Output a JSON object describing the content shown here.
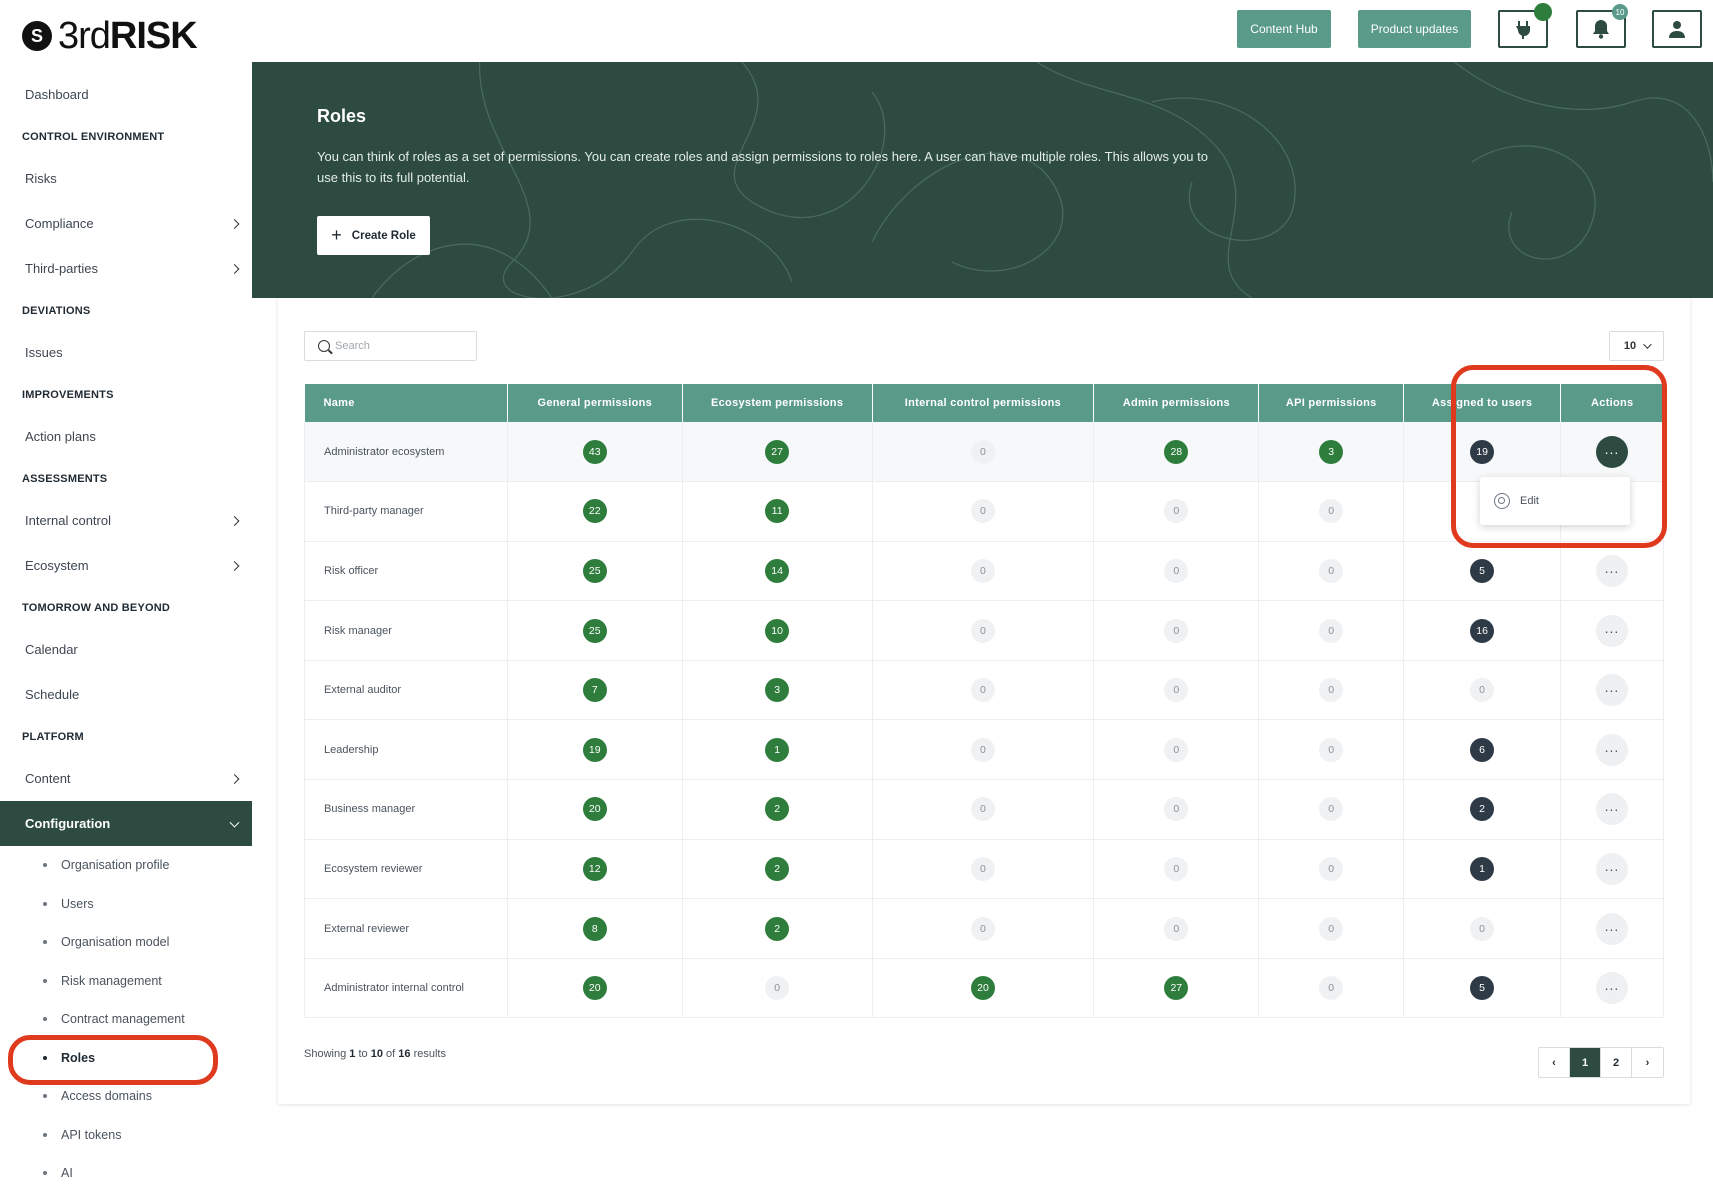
{
  "logo": {
    "mark": "S",
    "text_thin": "3rd",
    "text_bold": "RISK"
  },
  "topbar": {
    "content_hub": "Content Hub",
    "product_updates": "Product updates",
    "notification_count": "10"
  },
  "sidebar": {
    "dashboard": "Dashboard",
    "sec_control": "CONTROL ENVIRONMENT",
    "risks": "Risks",
    "compliance": "Compliance",
    "third_parties": "Third-parties",
    "sec_deviations": "DEVIATIONS",
    "issues": "Issues",
    "sec_improvements": "IMPROVEMENTS",
    "action_plans": "Action plans",
    "sec_assessments": "ASSESSMENTS",
    "internal_control": "Internal control",
    "ecosystem": "Ecosystem",
    "sec_tomorrow": "TOMORROW AND BEYOND",
    "calendar": "Calendar",
    "schedule": "Schedule",
    "sec_platform": "PLATFORM",
    "content": "Content",
    "configuration": "Configuration",
    "sub": [
      "Organisation profile",
      "Users",
      "Organisation model",
      "Risk management",
      "Contract management",
      "Roles",
      "Access domains",
      "API tokens",
      "AI"
    ]
  },
  "hero": {
    "title": "Roles",
    "description": "You can think of roles as a set of permissions. You can create roles and assign permissions to roles here. A user can have multiple roles. This allows you to use this to its full potential.",
    "create_label": "Create Role"
  },
  "table_controls": {
    "search_placeholder": "Search",
    "per_page": "10"
  },
  "columns": [
    "Name",
    "General permissions",
    "Ecosystem permissions",
    "Internal control permissions",
    "Admin permissions",
    "API permissions",
    "Assigned to users",
    "Actions"
  ],
  "rows": [
    {
      "name": "Administrator ecosystem",
      "general": "43",
      "ecosystem": "27",
      "internal": "0",
      "admin": "28",
      "api": "3",
      "users": "19"
    },
    {
      "name": "Third-party manager",
      "general": "22",
      "ecosystem": "11",
      "internal": "0",
      "admin": "0",
      "api": "0",
      "users": ""
    },
    {
      "name": "Risk officer",
      "general": "25",
      "ecosystem": "14",
      "internal": "0",
      "admin": "0",
      "api": "0",
      "users": "5"
    },
    {
      "name": "Risk manager",
      "general": "25",
      "ecosystem": "10",
      "internal": "0",
      "admin": "0",
      "api": "0",
      "users": "16"
    },
    {
      "name": "External auditor",
      "general": "7",
      "ecosystem": "3",
      "internal": "0",
      "admin": "0",
      "api": "0",
      "users": "0"
    },
    {
      "name": "Leadership",
      "general": "19",
      "ecosystem": "1",
      "internal": "0",
      "admin": "0",
      "api": "0",
      "users": "6"
    },
    {
      "name": "Business manager",
      "general": "20",
      "ecosystem": "2",
      "internal": "0",
      "admin": "0",
      "api": "0",
      "users": "2"
    },
    {
      "name": "Ecosystem reviewer",
      "general": "12",
      "ecosystem": "2",
      "internal": "0",
      "admin": "0",
      "api": "0",
      "users": "1"
    },
    {
      "name": "External reviewer",
      "general": "8",
      "ecosystem": "2",
      "internal": "0",
      "admin": "0",
      "api": "0",
      "users": "0"
    },
    {
      "name": "Administrator internal control",
      "general": "20",
      "ecosystem": "0",
      "internal": "20",
      "admin": "27",
      "api": "0",
      "users": "5"
    }
  ],
  "actions_menu": {
    "edit": "Edit"
  },
  "footer": {
    "showing_prefix": "Showing",
    "from": "1",
    "to_word": "to",
    "to": "10",
    "of_word": "of",
    "total": "16",
    "results_word": "results"
  },
  "pager": {
    "pages": [
      "1",
      "2"
    ],
    "prev": "‹",
    "next": "›"
  },
  "colors": {
    "brand_dark": "#2d4b41",
    "brand_teal": "#5a9a88",
    "pill_green": "#2e7d3c",
    "highlight": "#e03a1e"
  }
}
